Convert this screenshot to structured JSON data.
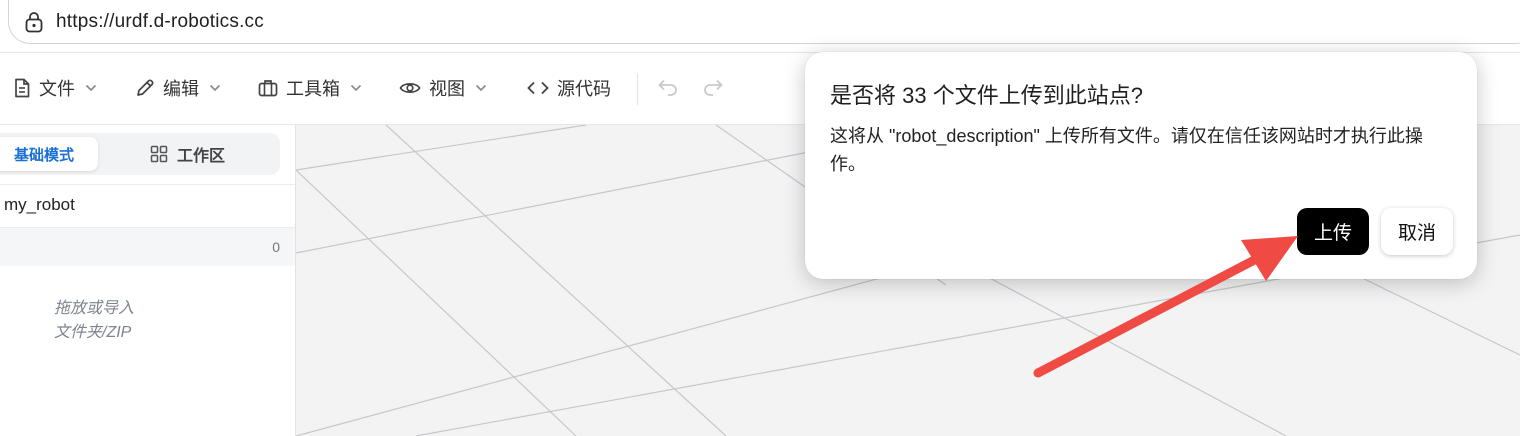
{
  "browser": {
    "url": "https://urdf.d-robotics.cc",
    "lock_icon": "lock-icon"
  },
  "toolbar": {
    "items": [
      {
        "label": "文件",
        "icon": "file-icon"
      },
      {
        "label": "编辑",
        "icon": "pencil-icon"
      },
      {
        "label": "工具箱",
        "icon": "toolbox-icon"
      },
      {
        "label": "视图",
        "icon": "eye-icon"
      },
      {
        "label": "源代码",
        "icon": "code-icon"
      }
    ],
    "undo_icon": "undo-icon",
    "redo_icon": "redo-icon"
  },
  "left_panel": {
    "mode_basic": "基础模式",
    "mode_workspace": "工作区",
    "robot_name": "my_robot",
    "count": "0",
    "dropzone_line1": "拖放或导入",
    "dropzone_line2": "文件夹/ZIP"
  },
  "dialog": {
    "title": "是否将 33 个文件上传到此站点?",
    "body": "这将从 \"robot_description\" 上传所有文件。请仅在信任该网站时才执行此操作。",
    "upload_label": "上传",
    "cancel_label": "取消"
  },
  "colors": {
    "accent": "#1a6fd6",
    "primary_button": "#000000",
    "annotation_arrow": "#f04a45",
    "viewport_bg": "#f3f3f4"
  }
}
